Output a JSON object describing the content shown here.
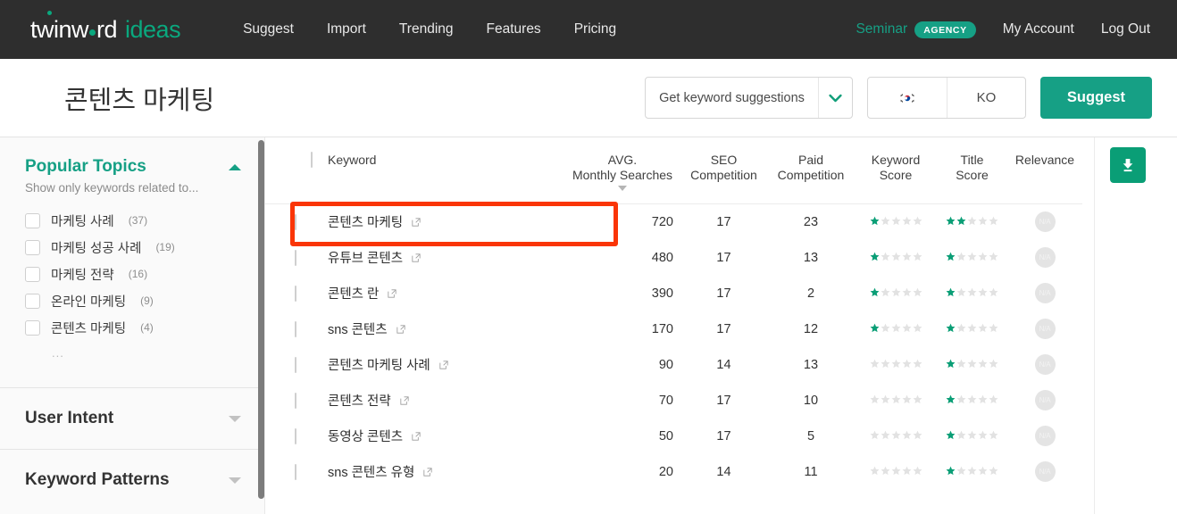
{
  "brand": {
    "logo_main": "twinw rd",
    "logo_main_pre": "twinw",
    "logo_main_post": "rd",
    "logo_sub": "ideas",
    "accent_color": "#16a085",
    "nav_bg": "#2e2e2e",
    "annotation_color": "#fa3507"
  },
  "topnav": {
    "links": [
      {
        "label": "Suggest",
        "name": "nav-link-suggest"
      },
      {
        "label": "Import",
        "name": "nav-link-import"
      },
      {
        "label": "Trending",
        "name": "nav-link-trending"
      },
      {
        "label": "Features",
        "name": "nav-link-features"
      },
      {
        "label": "Pricing",
        "name": "nav-link-pricing"
      }
    ],
    "account": {
      "user_name": "Seminar",
      "plan_badge": "AGENCY",
      "my_account": "My Account",
      "log_out": "Log Out"
    }
  },
  "search_row": {
    "page_title": "콘텐츠 마케팅",
    "mode_select": {
      "value": "Get keyword suggestions",
      "icon": "chevron-down-icon"
    },
    "language": {
      "flag_icon": "flag-south-korea-icon",
      "code": "KO"
    },
    "suggest_button": "Suggest"
  },
  "sidebar": {
    "popular_topics": {
      "title": "Popular Topics",
      "subtitle": "Show only keywords related to...",
      "collapse_icon": "triangle-up-icon",
      "ellipsis": "...",
      "items": [
        {
          "label": "마케팅 사례",
          "count": "(37)",
          "checked": false
        },
        {
          "label": "마케팅 성공 사례",
          "count": "(19)",
          "checked": false
        },
        {
          "label": "마케팅 전략",
          "count": "(16)",
          "checked": false
        },
        {
          "label": "온라인 마케팅",
          "count": "(9)",
          "checked": false
        },
        {
          "label": "콘텐츠 마케팅",
          "count": "(4)",
          "checked": false
        }
      ]
    },
    "user_intent": {
      "title": "User Intent",
      "expand_icon": "triangle-down-icon"
    },
    "keyword_patterns": {
      "title": "Keyword Patterns",
      "expand_icon": "triangle-down-icon"
    }
  },
  "table": {
    "select_all_checkbox": false,
    "headers": {
      "keyword": "Keyword",
      "avg_monthly_searches_l1": "AVG.",
      "avg_monthly_searches_l2": "Monthly Searches",
      "seo_competition_l1": "SEO",
      "seo_competition_l2": "Competition",
      "paid_competition_l1": "Paid",
      "paid_competition_l2": "Competition",
      "keyword_score_l1": "Keyword",
      "keyword_score_l2": "Score",
      "title_score_l1": "Title",
      "title_score_l2": "Score",
      "relevance": "Relevance"
    },
    "sorted_by": "avg_monthly_searches",
    "sort_direction": "desc",
    "relevance_placeholder": "N/A",
    "max_stars": 5,
    "rows": [
      {
        "keyword": "콘텐츠 마케팅",
        "avg_monthly_searches": "720",
        "seo_competition": "17",
        "paid_competition": "23",
        "keyword_score": 1,
        "title_score": 2,
        "relevance": "N/A",
        "highlighted": true
      },
      {
        "keyword": "유튜브 콘텐츠",
        "avg_monthly_searches": "480",
        "seo_competition": "17",
        "paid_competition": "13",
        "keyword_score": 1,
        "title_score": 1,
        "relevance": "N/A",
        "highlighted": false
      },
      {
        "keyword": "콘텐츠 란",
        "avg_monthly_searches": "390",
        "seo_competition": "17",
        "paid_competition": "2",
        "keyword_score": 1,
        "title_score": 1,
        "relevance": "N/A",
        "highlighted": false
      },
      {
        "keyword": "sns 콘텐츠",
        "avg_monthly_searches": "170",
        "seo_competition": "17",
        "paid_competition": "12",
        "keyword_score": 1,
        "title_score": 1,
        "relevance": "N/A",
        "highlighted": false
      },
      {
        "keyword": "콘텐츠 마케팅 사례",
        "avg_monthly_searches": "90",
        "seo_competition": "14",
        "paid_competition": "13",
        "keyword_score": 0,
        "title_score": 1,
        "relevance": "N/A",
        "highlighted": false
      },
      {
        "keyword": "콘텐츠 전략",
        "avg_monthly_searches": "70",
        "seo_competition": "17",
        "paid_competition": "10",
        "keyword_score": 0,
        "title_score": 1,
        "relevance": "N/A",
        "highlighted": false
      },
      {
        "keyword": "동영상 콘텐츠",
        "avg_monthly_searches": "50",
        "seo_competition": "17",
        "paid_competition": "5",
        "keyword_score": 0,
        "title_score": 1,
        "relevance": "N/A",
        "highlighted": false
      },
      {
        "keyword": "sns 콘텐츠 유형",
        "avg_monthly_searches": "20",
        "seo_competition": "14",
        "paid_competition": "11",
        "keyword_score": 0,
        "title_score": 1,
        "relevance": "N/A",
        "highlighted": false
      }
    ],
    "download_button": {
      "icon": "download-icon"
    }
  }
}
